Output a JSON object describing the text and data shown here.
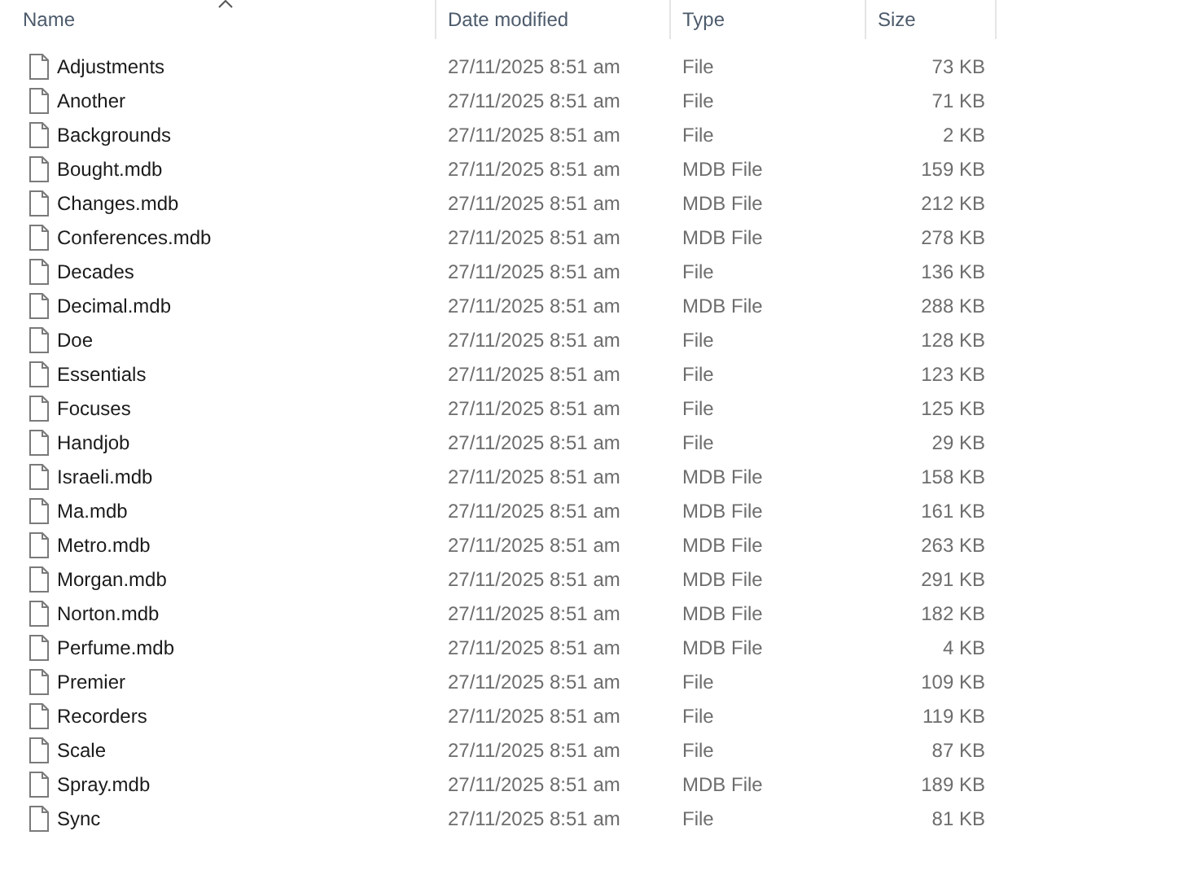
{
  "columns": [
    "Name",
    "Date modified",
    "Type",
    "Size"
  ],
  "files": [
    {
      "name": "Adjustments",
      "date": "27/11/2025 8:51 am",
      "type": "File",
      "size": "73 KB"
    },
    {
      "name": "Another",
      "date": "27/11/2025 8:51 am",
      "type": "File",
      "size": "71 KB"
    },
    {
      "name": "Backgrounds",
      "date": "27/11/2025 8:51 am",
      "type": "File",
      "size": "2 KB"
    },
    {
      "name": "Bought.mdb",
      "date": "27/11/2025 8:51 am",
      "type": "MDB File",
      "size": "159 KB"
    },
    {
      "name": "Changes.mdb",
      "date": "27/11/2025 8:51 am",
      "type": "MDB File",
      "size": "212 KB"
    },
    {
      "name": "Conferences.mdb",
      "date": "27/11/2025 8:51 am",
      "type": "MDB File",
      "size": "278 KB"
    },
    {
      "name": "Decades",
      "date": "27/11/2025 8:51 am",
      "type": "File",
      "size": "136 KB"
    },
    {
      "name": "Decimal.mdb",
      "date": "27/11/2025 8:51 am",
      "type": "MDB File",
      "size": "288 KB"
    },
    {
      "name": "Doe",
      "date": "27/11/2025 8:51 am",
      "type": "File",
      "size": "128 KB"
    },
    {
      "name": "Essentials",
      "date": "27/11/2025 8:51 am",
      "type": "File",
      "size": "123 KB"
    },
    {
      "name": "Focuses",
      "date": "27/11/2025 8:51 am",
      "type": "File",
      "size": "125 KB"
    },
    {
      "name": "Handjob",
      "date": "27/11/2025 8:51 am",
      "type": "File",
      "size": "29 KB"
    },
    {
      "name": "Israeli.mdb",
      "date": "27/11/2025 8:51 am",
      "type": "MDB File",
      "size": "158 KB"
    },
    {
      "name": "Ma.mdb",
      "date": "27/11/2025 8:51 am",
      "type": "MDB File",
      "size": "161 KB"
    },
    {
      "name": "Metro.mdb",
      "date": "27/11/2025 8:51 am",
      "type": "MDB File",
      "size": "263 KB"
    },
    {
      "name": "Morgan.mdb",
      "date": "27/11/2025 8:51 am",
      "type": "MDB File",
      "size": "291 KB"
    },
    {
      "name": "Norton.mdb",
      "date": "27/11/2025 8:51 am",
      "type": "MDB File",
      "size": "182 KB"
    },
    {
      "name": "Perfume.mdb",
      "date": "27/11/2025 8:51 am",
      "type": "MDB File",
      "size": "4 KB"
    },
    {
      "name": "Premier",
      "date": "27/11/2025 8:51 am",
      "type": "File",
      "size": "109 KB"
    },
    {
      "name": "Recorders",
      "date": "27/11/2025 8:51 am",
      "type": "File",
      "size": "119 KB"
    },
    {
      "name": "Scale",
      "date": "27/11/2025 8:51 am",
      "type": "File",
      "size": "87 KB"
    },
    {
      "name": "Spray.mdb",
      "date": "27/11/2025 8:51 am",
      "type": "MDB File",
      "size": "189 KB"
    },
    {
      "name": "Sync",
      "date": "27/11/2025 8:51 am",
      "type": "File",
      "size": "81 KB"
    }
  ]
}
